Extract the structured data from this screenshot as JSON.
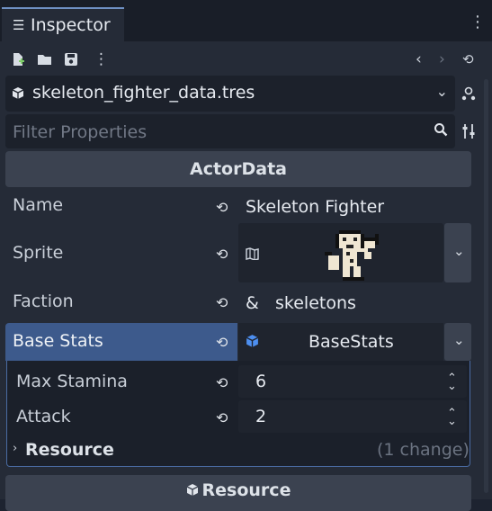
{
  "tab": {
    "icon": "list-icon",
    "title": "Inspector"
  },
  "toolbar": {
    "icons": [
      "new-resource-icon",
      "open-folder-icon",
      "save-icon",
      "more-icon",
      "back-icon",
      "forward-icon",
      "history-icon"
    ]
  },
  "resource": {
    "file": "skeleton_fighter_data.tres"
  },
  "filter": {
    "placeholder": "Filter Properties",
    "value": ""
  },
  "section": {
    "title": "ActorData"
  },
  "props": {
    "name": {
      "label": "Name",
      "value": "Skeleton Fighter"
    },
    "sprite": {
      "label": "Sprite"
    },
    "faction": {
      "label": "Faction",
      "prefix": "&",
      "value": "skeletons"
    },
    "base_stats": {
      "label": "Base Stats",
      "value": "BaseStats"
    }
  },
  "sub": {
    "max_stamina": {
      "label": "Max Stamina",
      "value": "6"
    },
    "attack": {
      "label": "Attack",
      "value": "2"
    },
    "resource": {
      "label": "Resource",
      "changes": "(1 change)"
    }
  },
  "footer": {
    "title": "Resource"
  },
  "colors": {
    "accent": "#3d5a8c",
    "border_accent": "#4a6ba3",
    "cube_blue": "#4d8ff0"
  }
}
